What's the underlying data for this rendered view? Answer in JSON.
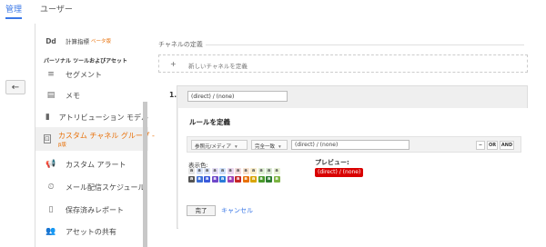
{
  "topnav": {
    "admin": "管理",
    "user": "ユーザー"
  },
  "gutter": {
    "back_icon": "←"
  },
  "sidebar": {
    "calc_metric": {
      "icon_text": "Dd",
      "label": "計算指標",
      "badge": "ベータ版"
    },
    "heading": "パーソナル ツールおよびアセット",
    "items": [
      {
        "label": "セグメント",
        "icon": "≡"
      },
      {
        "label": "メモ",
        "icon": "▤"
      },
      {
        "label": "アトリビューション モデル",
        "icon": "▮"
      },
      {
        "label": "カスタム チャネル グループ -",
        "icon": "⊡",
        "badge": "β版"
      },
      {
        "label": "カスタム アラート",
        "icon": "📢"
      },
      {
        "label": "メール配信スケジュール",
        "icon": "⏲"
      },
      {
        "label": "保存済みレポート",
        "icon": "▯"
      },
      {
        "label": "アセットの共有",
        "icon": "👥"
      }
    ]
  },
  "main": {
    "section_title": "チャネルの定義",
    "new_channel": {
      "plus": "+",
      "text": "新しいチャネルを定義"
    },
    "channel_number": "1.",
    "channel_name_value": "(direct) / (none)",
    "rules_title": "ルールを定義",
    "dimension_select": "参照元/メディア",
    "match_select": "完全一致",
    "value": "(direct) / (none)",
    "logic_minus": "−",
    "logic_or": "OR",
    "logic_and": "AND",
    "caret": "▾",
    "display_color_label": "表示色:",
    "preview_label": "プレビュー:",
    "preview_badge": "(direct) / (none)",
    "swatch_letter": "a",
    "done_button": "完了",
    "cancel_link": "キャンセル"
  },
  "colors": {
    "accent": "#3b78e7",
    "preview_red": "#d90000",
    "swatch_top": [
      "#e6e6e6",
      "#d9e3f7",
      "#dde4f5",
      "#e3dcf4",
      "#cfe0fb",
      "#e9d6ee",
      "#f2d9d9",
      "#f7e2cf",
      "#f8ecc9",
      "#e0efd6",
      "#d9e8d2",
      "#e8f2d6"
    ],
    "swatch_bottom": [
      "#555555",
      "#3d6fd6",
      "#3b5bdb",
      "#6f48c9",
      "#2a7cd9",
      "#9b3fb5",
      "#c62828",
      "#e8710a",
      "#d9a400",
      "#4a9a2c",
      "#2e7d32",
      "#7cb342"
    ]
  }
}
